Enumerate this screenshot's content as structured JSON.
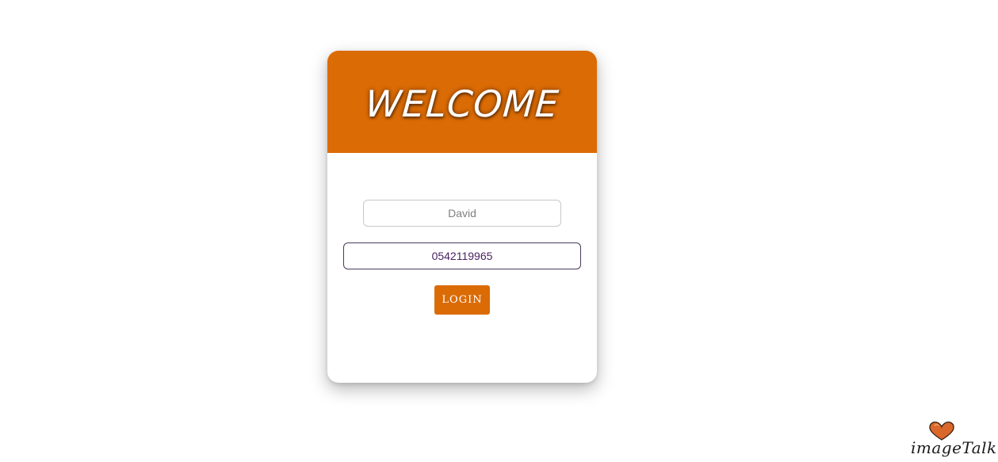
{
  "header": {
    "title": "WELCOME"
  },
  "form": {
    "name_placeholder": "David",
    "phone_value": "0542119965",
    "login_label": "LOGIN"
  },
  "brand": {
    "logo_text": "imageTalk",
    "logo_icon": "heart-icon"
  },
  "colors": {
    "accent": "#db6b05",
    "background": "#ffffff",
    "phone_text": "#4b2262"
  }
}
